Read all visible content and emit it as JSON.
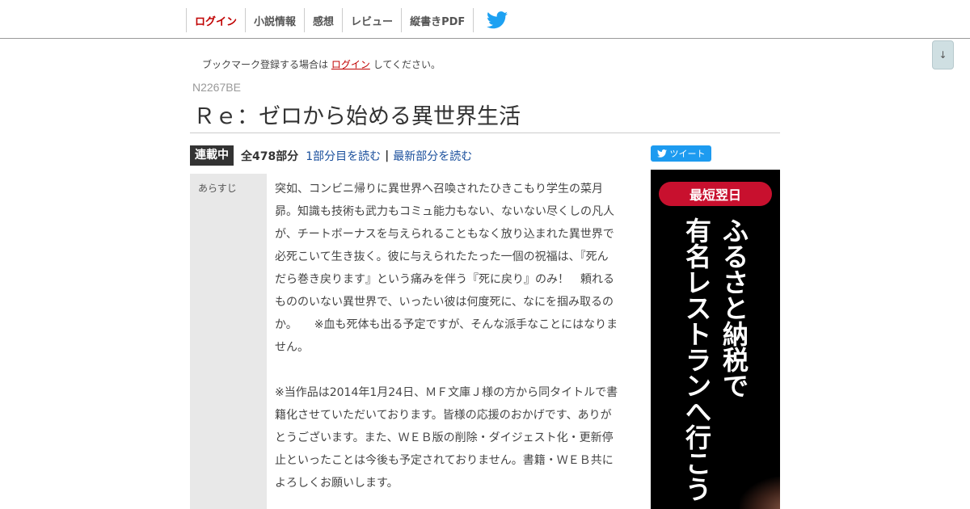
{
  "nav": {
    "items": [
      {
        "label": "ログイン",
        "active": true
      },
      {
        "label": "小説情報",
        "active": false
      },
      {
        "label": "感想",
        "active": false
      },
      {
        "label": "レビュー",
        "active": false
      },
      {
        "label": "縦書きPDF",
        "active": false
      }
    ],
    "twitter_icon": "twitter-bird-icon",
    "twitter_color": "#1da1f2"
  },
  "scroll_button": {
    "label": "↓"
  },
  "bookmark_notice": {
    "prefix": "ブックマーク登録する場合は",
    "link": "ログイン",
    "suffix": "してください。"
  },
  "novel": {
    "ncode": "N2267BE",
    "title": "Ｒｅ：ゼロから始める異世界生活",
    "status": "連載中",
    "episode_count": "全478部分",
    "first_episode_link": "1部分目を読む",
    "separator": "|",
    "latest_episode_link": "最新部分を読む"
  },
  "synopsis": {
    "label": "あらすじ",
    "paragraphs": [
      "突如、コンビニ帰りに異世界へ召喚されたひきこもり学生の菜月昴。知識も技術も武力もコミュ能力もない、ないない尽くしの凡人が、チートボーナスを与えられることもなく放り込まれた異世界で必死こいて生き抜く。彼に与えられたたった一個の祝福は、『死んだら巻き戻ります』という痛みを伴う『死に戻り』のみ！　頼れるもののいない異世界で、いったい彼は何度死に、なにを掴み取るのか。　　※血も死体も出る予定ですが、そんな派手なことにはなりません。",
      "※当作品は2014年1月24日、ＭＦ文庫Ｊ様の方から同タイトルで書籍化させていただいております。皆様の応援のおかげです、ありがとうございます。また、ＷＥＢ版の削除・ダイジェスト化・更新停止といったことは今後も予定されておりません。書籍・ＷＥＢ共によろしくお願いします。"
    ]
  },
  "tweet": {
    "label": "ツイート",
    "color": "#1d9bf0"
  },
  "ad": {
    "badge": "最短翌日",
    "badge_color": "#c8102e",
    "right_column": "ふるさと納税で",
    "left_column": "有名レストランへ行こう"
  },
  "colors": {
    "accent_red": "#c00000",
    "link_blue": "#1a4f9c",
    "status_badge_bg": "#333333",
    "synopsis_label_bg": "#e8e8e8"
  }
}
